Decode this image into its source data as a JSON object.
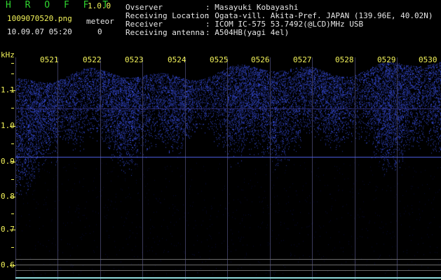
{
  "header": {
    "app_title": "H R O F F T",
    "version": "1.0.0",
    "filename": "1009070520.png",
    "datetime": "10.09.07 05:20",
    "meteor_label": "meteor",
    "meteor_count": "0"
  },
  "info": {
    "rows": [
      {
        "key": "Ovserver",
        "value": ": Masayuki Kobayashi"
      },
      {
        "key": "Receiving Location",
        "value": ": Ogata-vill. Akita-Pref. JAPAN (139.96E, 40.02N)"
      },
      {
        "key": "Receiver",
        "value": ": ICOM IC-575 53.7492(@LCD)MHz USB"
      },
      {
        "key": "Receiving antenna",
        "value": ": A504HB(yagi 4el)"
      }
    ]
  },
  "spectrogram": {
    "y_unit": "kHz",
    "y_ticks": [
      "1.1",
      "1.0",
      "0.9",
      "0.8",
      "0.7",
      "0.6"
    ],
    "x_ticks": [
      "0521",
      "0522",
      "0523",
      "0524",
      "0525",
      "0526",
      "0527",
      "0528",
      "0529",
      "0530"
    ],
    "colors": {
      "label": "#f3f35a",
      "header": "#2fd42f",
      "signal": "#3c5cff",
      "text": "#e8e8e8"
    }
  }
}
